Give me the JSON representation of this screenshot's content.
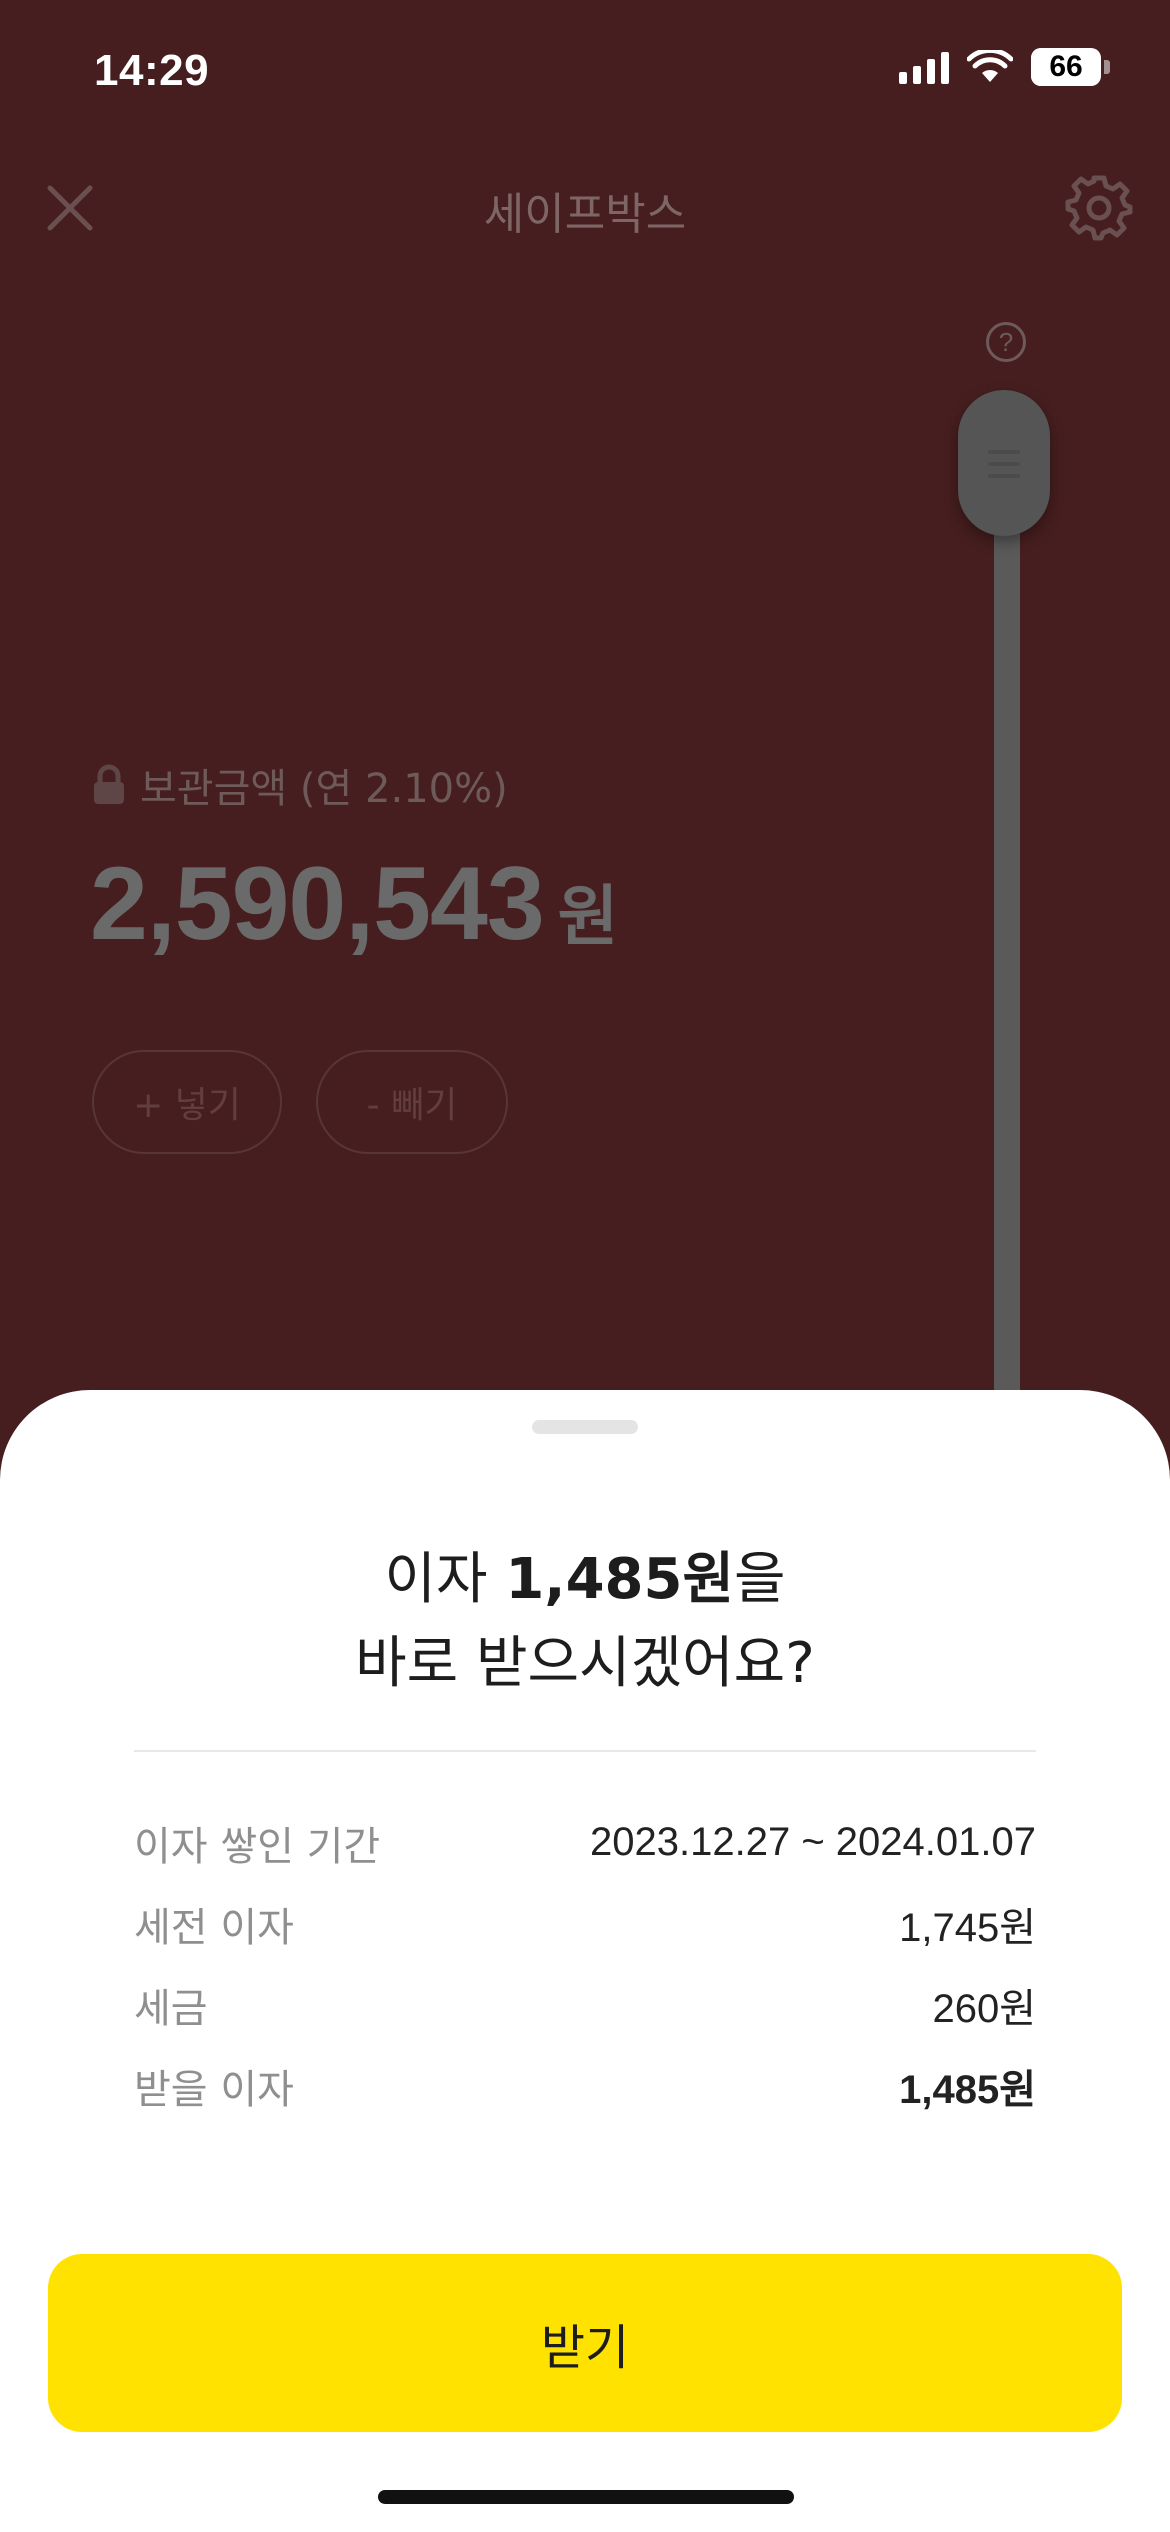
{
  "status_bar": {
    "time": "14:29",
    "battery_level": "66",
    "battery_percent": 66
  },
  "nav": {
    "title": "세이프박스",
    "close_icon": "close-icon",
    "settings_icon": "gear-icon"
  },
  "slider": {
    "help_icon": "question-icon",
    "help_glyph": "?"
  },
  "balance": {
    "label": "보관금액 (연 2.10%)",
    "amount": "2,590,543",
    "unit": "원",
    "lock_icon": "lock-icon"
  },
  "actions": {
    "deposit_label": "+ 넣기",
    "withdraw_label": "- 빼기"
  },
  "sheet": {
    "title_prefix": "이자 ",
    "title_amount": "1,485원",
    "title_suffix": "을",
    "title_line2": "바로 받으시겠어요?",
    "rows": [
      {
        "label": "이자 쌓인 기간",
        "value": "2023.12.27 ~ 2024.01.07"
      },
      {
        "label": "세전 이자",
        "value": "1,745원"
      },
      {
        "label": "세금",
        "value": "260원"
      },
      {
        "label": "받을 이자",
        "value": "1,485원"
      }
    ],
    "confirm_label": "받기"
  },
  "colors": {
    "background": "#461e1f",
    "accent": "#ffe200",
    "sheet": "#ffffff"
  }
}
